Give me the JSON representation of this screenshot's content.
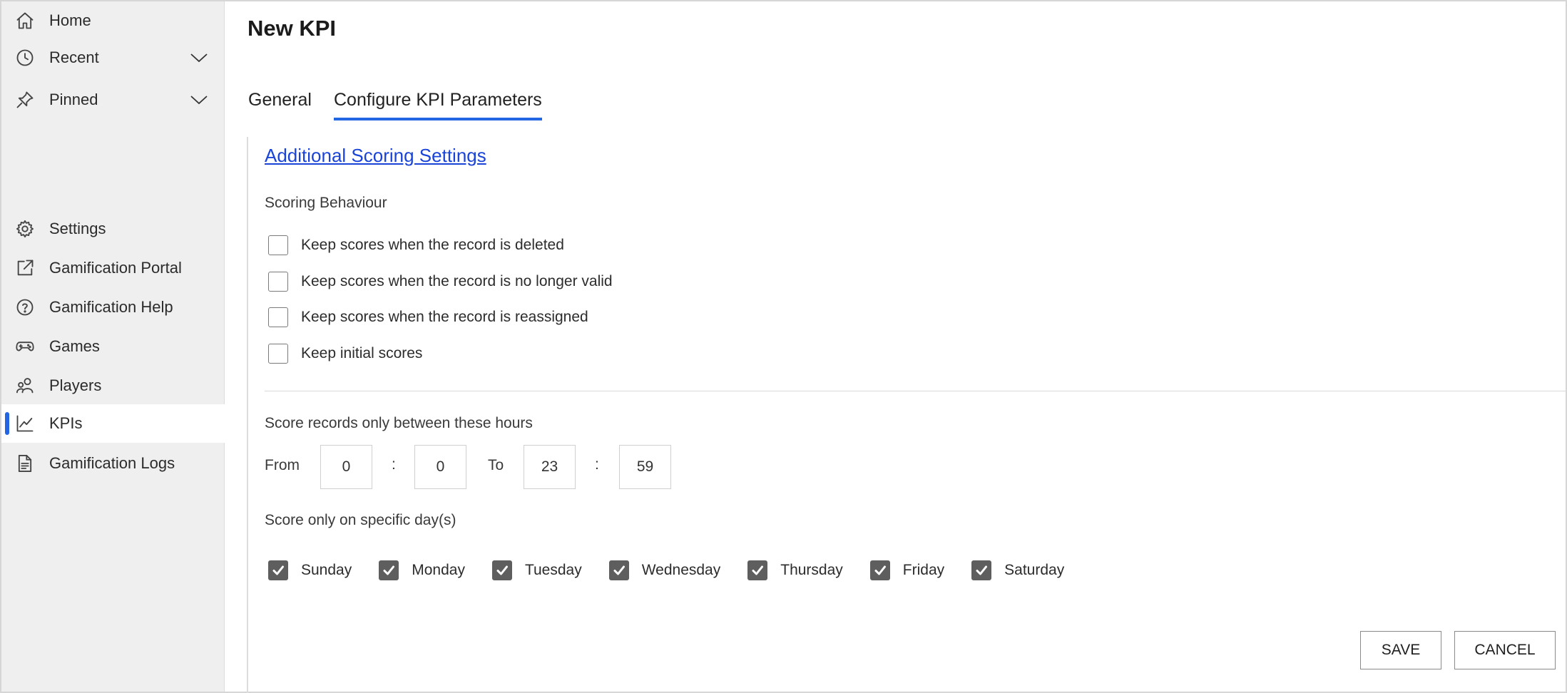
{
  "sidebar": {
    "items": [
      {
        "label": "Home",
        "icon": "home-icon"
      },
      {
        "label": "Recent",
        "icon": "clock-icon",
        "expandable": true
      },
      {
        "label": "Pinned",
        "icon": "pin-icon",
        "expandable": true
      },
      {
        "label": "Settings",
        "icon": "gear-icon"
      },
      {
        "label": "Gamification Portal",
        "icon": "external-link-icon"
      },
      {
        "label": "Gamification Help",
        "icon": "help-icon"
      },
      {
        "label": "Games",
        "icon": "gamepad-icon"
      },
      {
        "label": "Players",
        "icon": "people-icon"
      },
      {
        "label": "KPIs",
        "icon": "chart-line-icon",
        "active": true
      },
      {
        "label": "Gamification Logs",
        "icon": "document-icon"
      }
    ]
  },
  "page": {
    "title": "New KPI",
    "tabs": [
      {
        "label": "General",
        "active": false
      },
      {
        "label": "Configure KPI Parameters",
        "active": true
      }
    ]
  },
  "settings": {
    "link": "Additional Scoring Settings",
    "scoring_behaviour_label": "Scoring Behaviour",
    "checkboxes": [
      {
        "label": "Keep scores when the record is deleted",
        "checked": false
      },
      {
        "label": "Keep scores when the record is no longer valid",
        "checked": false
      },
      {
        "label": "Keep scores when the record is reassigned",
        "checked": false
      },
      {
        "label": "Keep initial scores",
        "checked": false
      }
    ],
    "hours_label": "Score records only between these hours",
    "from_label": "From",
    "to_label": "To",
    "separator": ":",
    "from_hour": "0",
    "from_minute": "0",
    "to_hour": "23",
    "to_minute": "59",
    "days_label": "Score only on specific day(s)",
    "days": [
      {
        "label": "Sunday",
        "checked": true
      },
      {
        "label": "Monday",
        "checked": true
      },
      {
        "label": "Tuesday",
        "checked": true
      },
      {
        "label": "Wednesday",
        "checked": true
      },
      {
        "label": "Thursday",
        "checked": true
      },
      {
        "label": "Friday",
        "checked": true
      },
      {
        "label": "Saturday",
        "checked": true
      }
    ]
  },
  "actions": {
    "save_label": "SAVE",
    "cancel_label": "CANCEL"
  },
  "colors": {
    "accent": "#2266e3",
    "link": "#1a44d8",
    "checkbox_checked": "#5e5e5e",
    "sidebar_bg": "#efefef"
  }
}
